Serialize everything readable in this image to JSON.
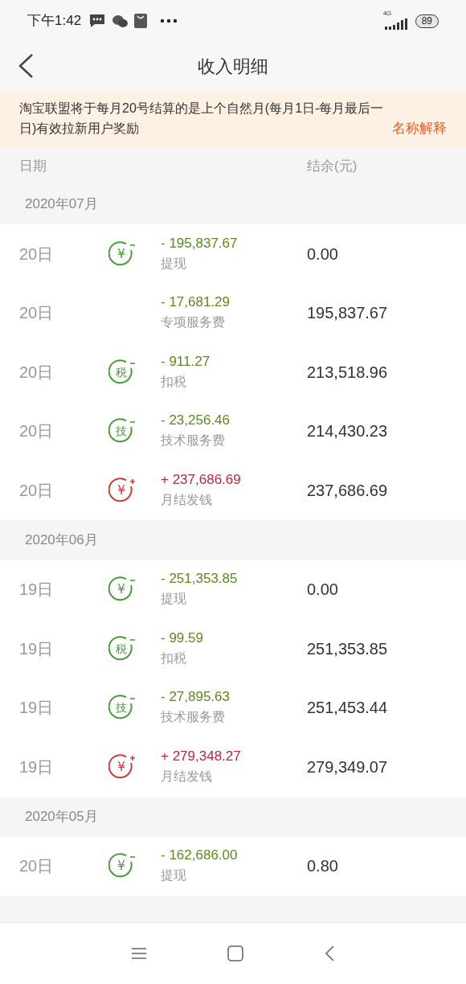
{
  "status_bar": {
    "time": "下午1:42",
    "network": "4G",
    "battery": "89"
  },
  "header": {
    "title": "收入明细"
  },
  "notice": {
    "text": "淘宝联盟将于每月20号结算的是上个自然月(每月1日-每月最后一日)有效拉新用户奖励",
    "link": "名称解释"
  },
  "columns": [
    "日期",
    "结余(元)"
  ],
  "months": [
    {
      "label": "2020年07月",
      "rows": [
        {
          "date": "20日",
          "kind": "withdraw",
          "icon": "¥",
          "amount": "- 195,837.67",
          "type": "提现",
          "balance": "0.00"
        },
        {
          "date": "20日",
          "kind": "fee",
          "amount": "- 17,681.29",
          "type": "专项服务费",
          "balance": "195,837.67"
        },
        {
          "date": "20日",
          "kind": "tax",
          "icon": "税",
          "amount": "- 911.27",
          "type": "扣税",
          "balance": "213,518.96"
        },
        {
          "date": "20日",
          "kind": "tech",
          "icon": "技",
          "amount": "- 23,256.46",
          "type": "技术服务费",
          "balance": "214,430.23"
        },
        {
          "date": "20日",
          "kind": "income",
          "icon": "¥",
          "amount": "+ 237,686.69",
          "type": "月结发钱",
          "balance": "237,686.69"
        }
      ]
    },
    {
      "label": "2020年06月",
      "rows": [
        {
          "date": "19日",
          "kind": "withdraw",
          "icon": "¥",
          "amount": "- 251,353.85",
          "type": "提现",
          "balance": "0.00"
        },
        {
          "date": "19日",
          "kind": "tax",
          "icon": "税",
          "amount": "- 99.59",
          "type": "扣税",
          "balance": "251,353.85"
        },
        {
          "date": "19日",
          "kind": "tech",
          "icon": "技",
          "amount": "- 27,895.63",
          "type": "技术服务费",
          "balance": "251,453.44"
        },
        {
          "date": "19日",
          "kind": "income",
          "icon": "¥",
          "amount": "+ 279,348.27",
          "type": "月结发钱",
          "balance": "279,349.07"
        }
      ]
    },
    {
      "label": "2020年05月",
      "rows": [
        {
          "date": "20日",
          "kind": "withdraw",
          "icon": "¥",
          "amount": "- 162,686.00",
          "type": "提现",
          "balance": "0.80"
        }
      ]
    }
  ]
}
